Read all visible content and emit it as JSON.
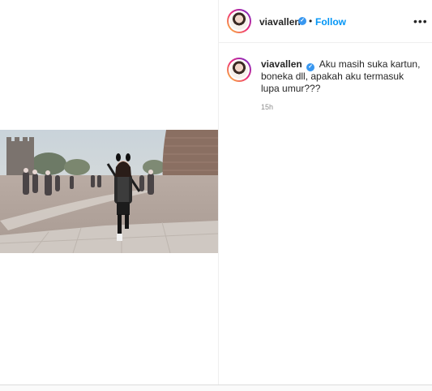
{
  "post": {
    "header": {
      "username": "viavallen",
      "separator": "•",
      "follow_label": "Follow",
      "more_label": "•••"
    },
    "caption": {
      "username": "viavallen",
      "text": "Aku masih suka kartun, boneka dll, apakah aku termasuk lupa umur???",
      "timestamp": "15h"
    }
  },
  "colors": {
    "follow_blue": "#0095f6",
    "verified_blue": "#3897f0",
    "text": "#262626",
    "muted": "#8e8e8e"
  },
  "icons": [
    "verified-badge-icon",
    "more-options-icon"
  ]
}
